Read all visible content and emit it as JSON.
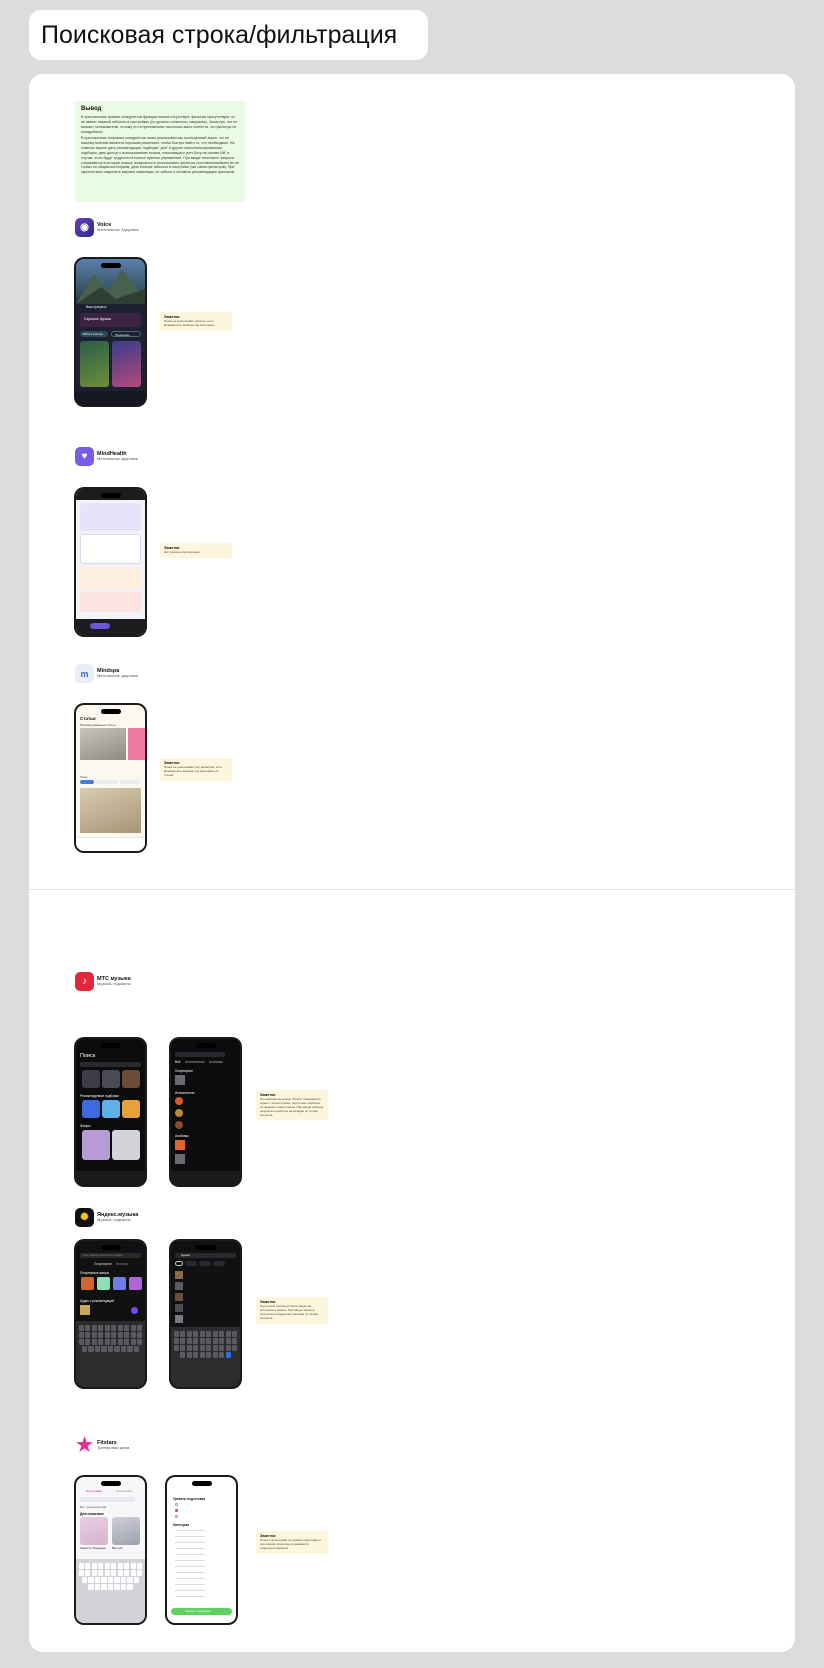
{
  "page": {
    "title": "Поисковая строка/фильтрация"
  },
  "conclusion": {
    "title": "Вывод",
    "p1": "В приложениях прямых конкурентов функция поиска отсутствует, фильтры присутствуют, но не имеют никакой гибкости в настройках (по уровню сложности, например). Зачастую, это не мешает пользователю, потому что в приложениях настолько мало контента, что фильтры не понадобятся.",
    "p2": "В приложениях непрямых конкурентов поиск реализован как полноценный экран, что по нашему мнению является хорошим решением, чтобы быстро найти то, что необходимо. На главном экране дать рекомендации, подборки \"для\" и другие персонализированные подборки, дать доступ к использованию поиска, помогающего учет-боту на основе ИИ, в случае, если будут трудности в поиске нужного упражнения. При вводе текстового запроса сохраняются в истории поиска, возможность использовать фильтры (составить/выбрать их не только по общим категориям, дать больше гибкости в настройке уже самих фильтров). При скролле вниз закрепить вариант навигации, не забыть и оставить рекомендацию фильтров."
  },
  "apps": {
    "voice": {
      "name": "Voice",
      "sub": "Ментальное Здоровье",
      "note_title": "Заметки",
      "note_text": "Поиск не реализован, фильтр, есть возможность выбора под категорию."
    },
    "mindhealth": {
      "name": "MindHealth",
      "sub": "Ментальное здоровье",
      "note_title": "Заметки",
      "note_text": "Нет поиска и фильтрации."
    },
    "mindspa": {
      "name": "Mindspa",
      "sub": "Ментальное здоровье",
      "note_title": "Заметки",
      "note_text": "Поиск не реализован, нет фильтров, есть возможность выбора под категорию из статей."
    },
    "mts": {
      "name": "МТС музыка",
      "sub": "Музыка, подкасты",
      "note_title": "Заметки",
      "note_text": "По нажатию на кнопку \"Поиск\" открывается экран с полем поиска, под полем подборки по жанрам и настроению. При вводе запроса результаты разбиты на вкладки по типам контента."
    },
    "yandex": {
      "name": "Яндекс.музыка",
      "sub": "Музыка, подкасты",
      "note_title": "Заметки",
      "note_text": "Под полем поиска история запросов, категории и жанры. При вводе запроса результаты разделены чипсами по типам контента."
    },
    "fitstars": {
      "name": "Fitstars",
      "sub": "Тренировки дома",
      "note_title": "Заметки",
      "note_text": "Поиск с фильтрами по уровню подготовки и категориям, фильтры открываются отдельным экраном."
    }
  },
  "screens": {
    "voice": {
      "greeting": "Ваш прогресс",
      "card_title": "Скрытые фразы",
      "btn1": "Войти в систему",
      "btn2": "Продолжить"
    },
    "mts": {
      "search_title": "Поиск",
      "recs": "Рекомендуемые подборки",
      "genres": "Жанры",
      "tab_all": "Всё",
      "tab_artists": "Исполнители",
      "tab_albums": "Альбомы",
      "sec_popular": "Популярное",
      "sec_artists": "Исполнители",
      "sec_albums": "Альбомы"
    },
    "yandex": {
      "placeholder": "Трек, альбом, исполнитель, подкаст",
      "tab1": "Популярное",
      "tab2": "История",
      "genres": "Популярные жанры",
      "podcasts": "Аудио с рекомендаций",
      "query": "музыка"
    },
    "fitstars": {
      "tab1": "Программы",
      "tab2": "Тренировки",
      "results": "Все тренировки (40)",
      "section": "Для новичков",
      "card1": "Скорость. Похудение",
      "card2": "Всё тело",
      "filter_title": "Уровень подготовки",
      "cat_title": "Категории",
      "apply": "Показать тренировки"
    },
    "mindspa": {
      "title": "Статьи",
      "sec1": "Рекомендованные статьи",
      "sec2": "Темы"
    }
  }
}
